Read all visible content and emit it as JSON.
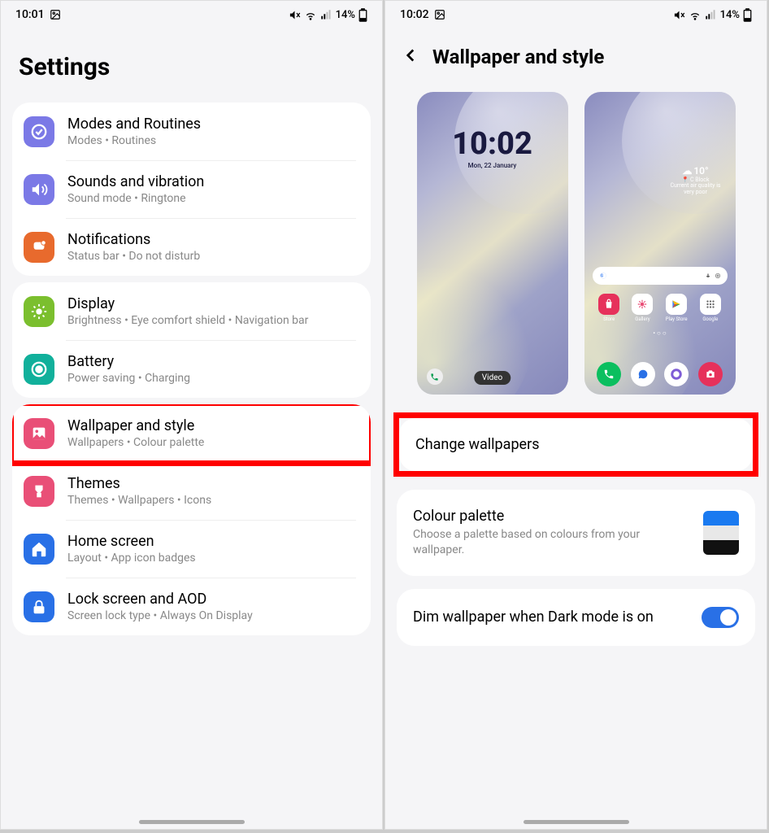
{
  "status": {
    "time1": "10:01",
    "time2": "10:02",
    "battery": "14%"
  },
  "screen1": {
    "title": "Settings",
    "groups": [
      {
        "items": [
          {
            "key": "modes",
            "title": "Modes and Routines",
            "sub": "Modes  •  Routines",
            "color": "#7b79e6",
            "icon": "check"
          },
          {
            "key": "sounds",
            "title": "Sounds and vibration",
            "sub": "Sound mode  •  Ringtone",
            "color": "#7b79e6",
            "icon": "sound"
          },
          {
            "key": "notifications",
            "title": "Notifications",
            "sub": "Status bar  •  Do not disturb",
            "color": "#e86a2d",
            "icon": "notif"
          }
        ]
      },
      {
        "items": [
          {
            "key": "display",
            "title": "Display",
            "sub": "Brightness  •  Eye comfort shield  •  Navigation bar",
            "color": "#7bbf2e",
            "icon": "brightness"
          },
          {
            "key": "battery",
            "title": "Battery",
            "sub": "Power saving  •  Charging",
            "color": "#11b09b",
            "icon": "battery"
          }
        ]
      },
      {
        "items": [
          {
            "key": "wallpaper",
            "title": "Wallpaper and style",
            "sub": "Wallpapers  •  Colour palette",
            "color": "#e94f77",
            "icon": "wallpaper",
            "highlight": true
          },
          {
            "key": "themes",
            "title": "Themes",
            "sub": "Themes  •  Wallpapers  •  Icons",
            "color": "#e94f77",
            "icon": "themes"
          },
          {
            "key": "home",
            "title": "Home screen",
            "sub": "Layout  •  App icon badges",
            "color": "#2970e6",
            "icon": "home"
          },
          {
            "key": "lock",
            "title": "Lock screen and AOD",
            "sub": "Screen lock type  •  Always On Display",
            "color": "#2970e6",
            "icon": "lock"
          }
        ]
      }
    ]
  },
  "screen2": {
    "title": "Wallpaper and style",
    "lock_preview": {
      "time": "10:02",
      "date": "Mon, 22 January",
      "chip": "Video"
    },
    "home_preview": {
      "weather": {
        "temp": "10°",
        "loc": "C Block",
        "sub": "Current air quality is very poor"
      },
      "row1": [
        "Store",
        "Gallery",
        "Play Store",
        "Google"
      ]
    },
    "change": "Change wallpapers",
    "palette_title": "Colour palette",
    "palette_sub": "Choose a palette based on colours from your wallpaper.",
    "palette_colors": [
      "#1a7af0",
      "#e8e8e8",
      "#111111"
    ],
    "dim_title": "Dim wallpaper when Dark mode is on",
    "dim_on": true
  }
}
